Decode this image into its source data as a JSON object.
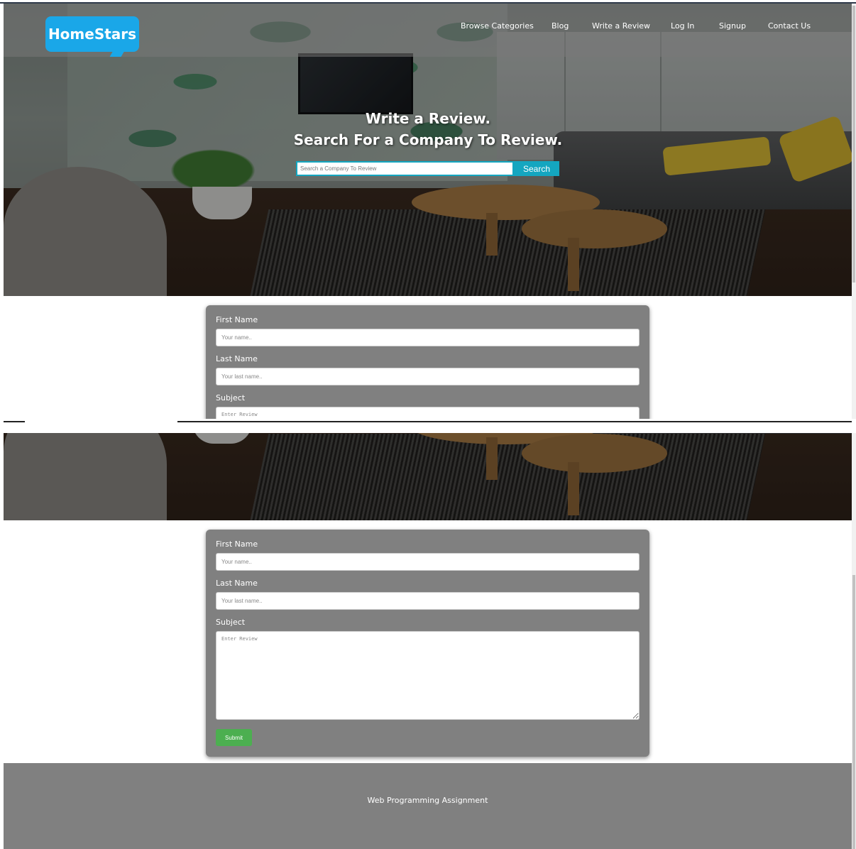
{
  "brand": {
    "logo_text": "HomeStars"
  },
  "nav": {
    "links": [
      "Browse Categories",
      "Blog",
      "Write a Review",
      "Log In",
      "Signup",
      "Contact Us"
    ]
  },
  "hero": {
    "title_line1": "Write a Review.",
    "title_line2": "Search For a Company To Review.",
    "search_placeholder": "Search a Company To Review",
    "search_button": "Search"
  },
  "form": {
    "first_name_label": "First Name",
    "first_name_placeholder": "Your name..",
    "last_name_label": "Last Name",
    "last_name_placeholder": "Your last name..",
    "subject_label": "Subject",
    "subject_placeholder": "Enter Review",
    "submit_label": "Submit"
  },
  "footer": {
    "text": "Web Programming Assignment"
  },
  "colors": {
    "accent": "#14a6c0",
    "logo": "#1aa7e8",
    "submit": "#4caf50",
    "panel": "#808080"
  }
}
